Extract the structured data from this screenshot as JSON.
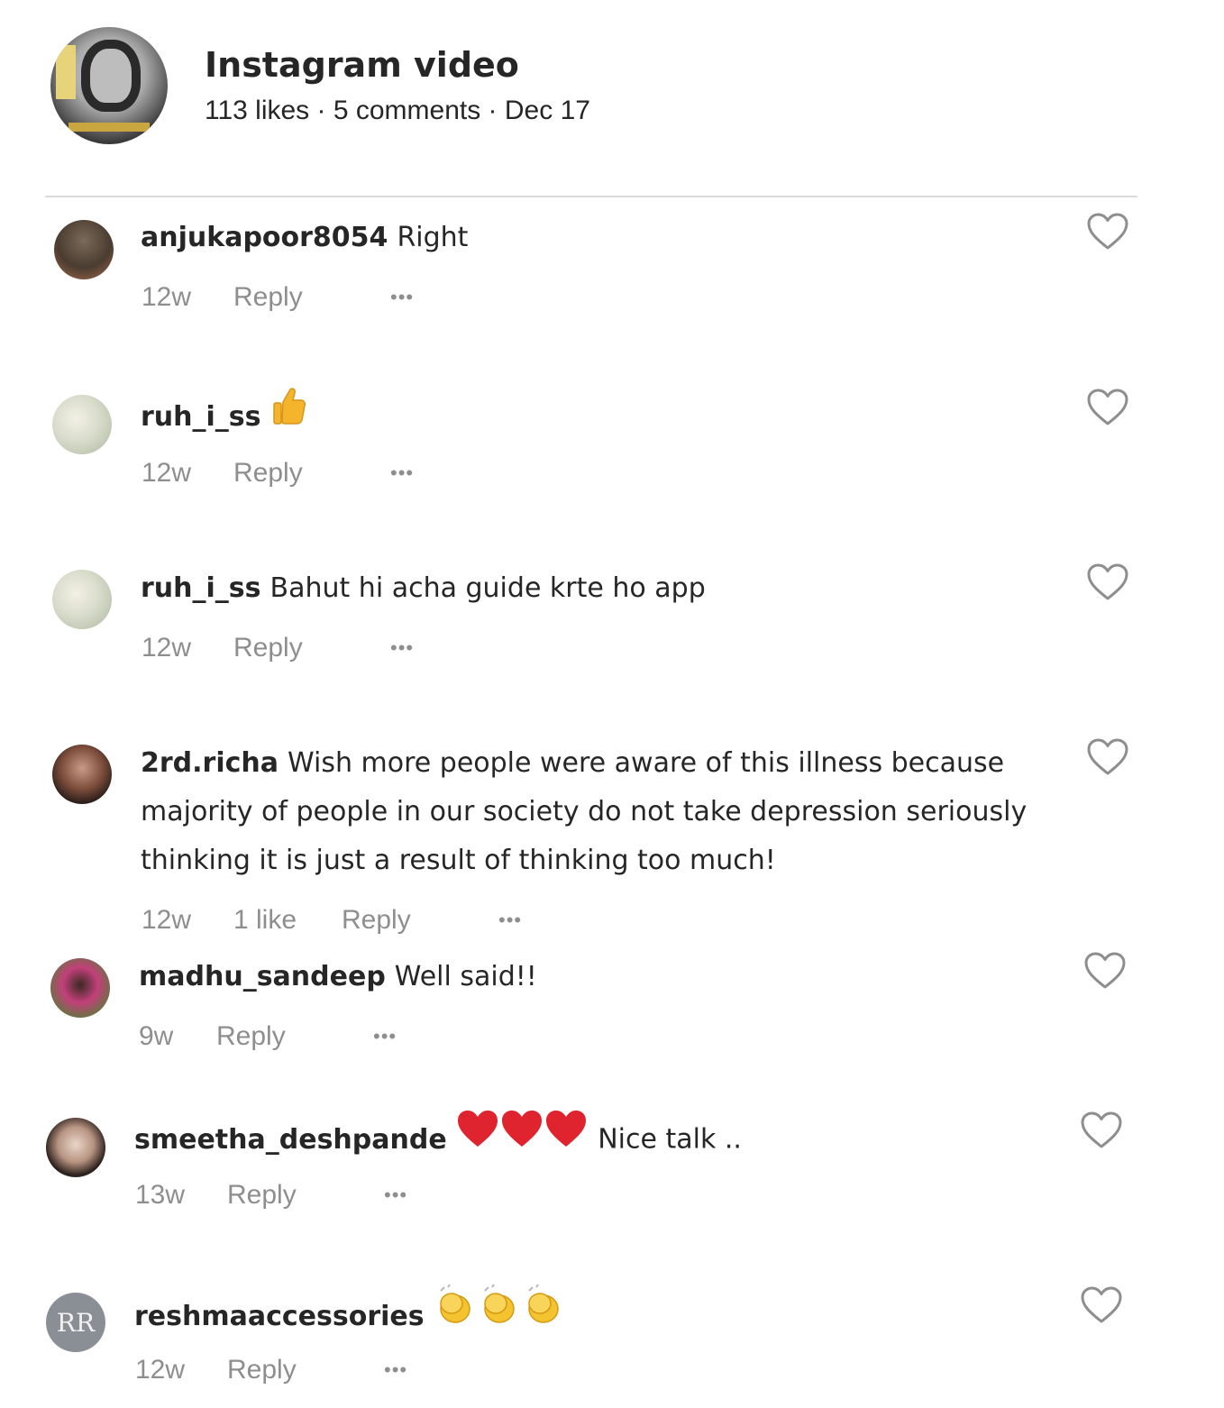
{
  "post": {
    "title": "Instagram video",
    "meta": "113 likes · 5 comments · Dec 17"
  },
  "icons": {
    "heart": "heart-outline-icon",
    "more": "more-dots-icon",
    "thumbs_up": "thumbs-up-emoji",
    "red_heart": "red-heart-emoji",
    "clap": "clapping-hands-emoji"
  },
  "colors": {
    "username": "#262626",
    "meta": "#8e8e8e",
    "divider": "#dbdbdb",
    "heart_emoji": "#e0242f",
    "clap_emoji": "#f4c430",
    "thumbs_emoji": "#f4b52c"
  },
  "comments": [
    {
      "username": "anjukapoor8054",
      "text": "Right",
      "time": "12w",
      "reply": "Reply"
    },
    {
      "username": "ruh_i_ss",
      "text": "",
      "time": "12w",
      "reply": "Reply"
    },
    {
      "username": "ruh_i_ss",
      "text": "Bahut hi acha guide krte ho app",
      "time": "12w",
      "reply": "Reply"
    },
    {
      "username": "2rd.richa",
      "text": "Wish more people were aware of this illness because majority of people in our society do not take depression seriously thinking it is just a result of thinking too much!",
      "time": "12w",
      "likes": "1 like",
      "reply": "Reply"
    },
    {
      "username": "madhu_sandeep",
      "text": "Well said!!",
      "time": "9w",
      "reply": "Reply"
    },
    {
      "username": "smeetha_deshpande",
      "text": "Nice talk ..",
      "time": "13w",
      "reply": "Reply"
    },
    {
      "username": "reshmaaccessories",
      "text": "",
      "time": "12w",
      "reply": "Reply",
      "avatar_text": "RR"
    }
  ]
}
